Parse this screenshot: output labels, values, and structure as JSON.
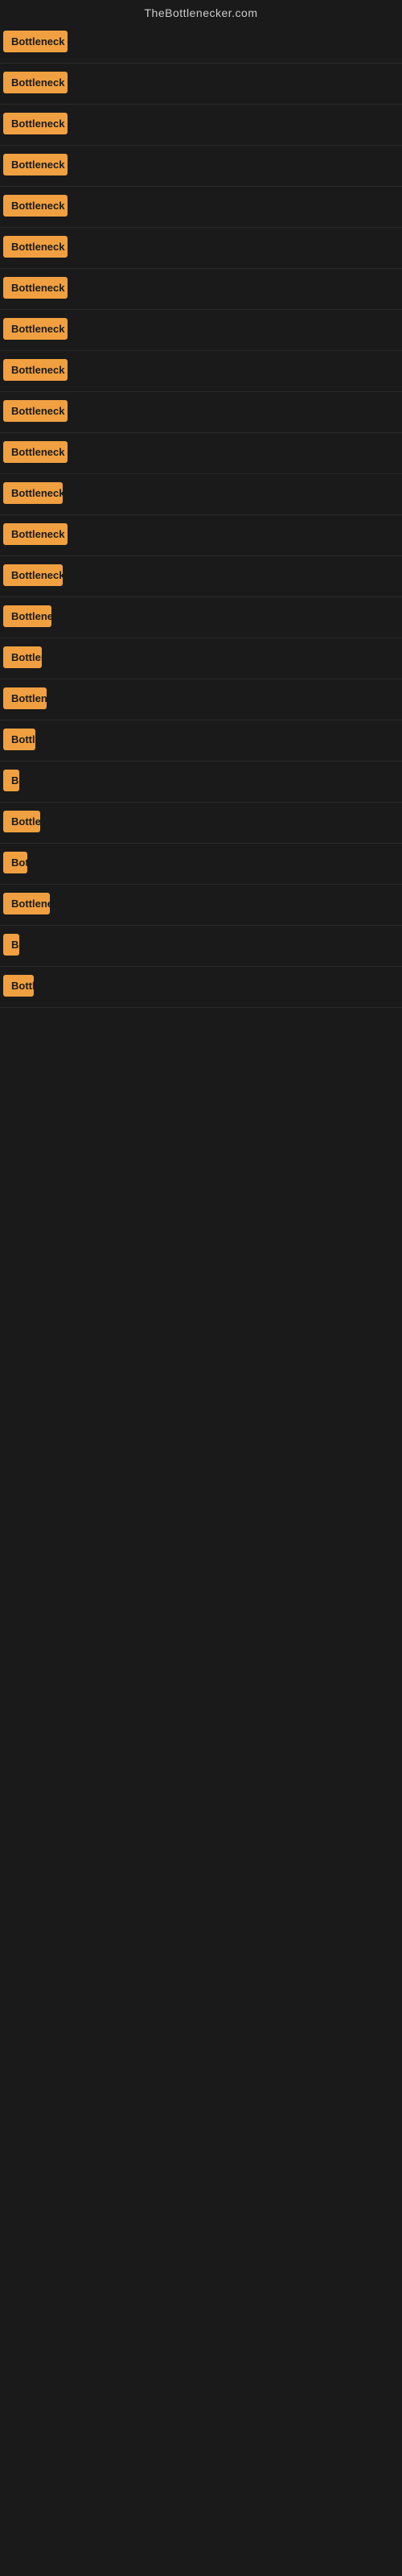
{
  "site": {
    "title": "TheBottlenecker.com"
  },
  "badge_label": "Bottleneck result",
  "rows": [
    {
      "id": 1,
      "row_class": "row-1"
    },
    {
      "id": 2,
      "row_class": "row-2"
    },
    {
      "id": 3,
      "row_class": "row-3"
    },
    {
      "id": 4,
      "row_class": "row-4"
    },
    {
      "id": 5,
      "row_class": "row-5"
    },
    {
      "id": 6,
      "row_class": "row-6"
    },
    {
      "id": 7,
      "row_class": "row-7"
    },
    {
      "id": 8,
      "row_class": "row-8"
    },
    {
      "id": 9,
      "row_class": "row-9"
    },
    {
      "id": 10,
      "row_class": "row-10"
    },
    {
      "id": 11,
      "row_class": "row-11"
    },
    {
      "id": 12,
      "row_class": "row-12"
    },
    {
      "id": 13,
      "row_class": "row-13"
    },
    {
      "id": 14,
      "row_class": "row-14"
    },
    {
      "id": 15,
      "row_class": "row-15"
    },
    {
      "id": 16,
      "row_class": "row-16"
    },
    {
      "id": 17,
      "row_class": "row-17"
    },
    {
      "id": 18,
      "row_class": "row-18"
    },
    {
      "id": 19,
      "row_class": "row-19"
    },
    {
      "id": 20,
      "row_class": "row-20"
    },
    {
      "id": 21,
      "row_class": "row-21"
    },
    {
      "id": 22,
      "row_class": "row-22"
    },
    {
      "id": 23,
      "row_class": "row-23"
    },
    {
      "id": 24,
      "row_class": "row-24"
    }
  ]
}
